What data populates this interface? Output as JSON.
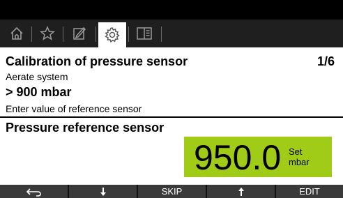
{
  "tabs": [
    {
      "icon": "home-icon"
    },
    {
      "icon": "star-icon"
    },
    {
      "icon": "edit-icon"
    },
    {
      "icon": "gear-icon",
      "active": true
    },
    {
      "icon": "book-icon"
    }
  ],
  "header": {
    "title": "Calibration of pressure sensor",
    "page_indicator": "1/6"
  },
  "step": {
    "name": "Aerate system",
    "target": "> 900 mbar",
    "instruction": "Enter value of reference sensor"
  },
  "sensor": {
    "label": "Pressure reference sensor",
    "value": "950.0",
    "status": "Set",
    "unit": "mbar"
  },
  "softkeys": [
    {
      "icon": "back-arrow-icon"
    },
    {
      "icon": "arrow-down-icon"
    },
    {
      "label": "SKIP"
    },
    {
      "icon": "arrow-up-icon"
    },
    {
      "label": "EDIT"
    }
  ],
  "colors": {
    "value_background": "#a0cc17",
    "tab_bar": "#1f1f1f",
    "softkey": "#3a3a3a"
  }
}
